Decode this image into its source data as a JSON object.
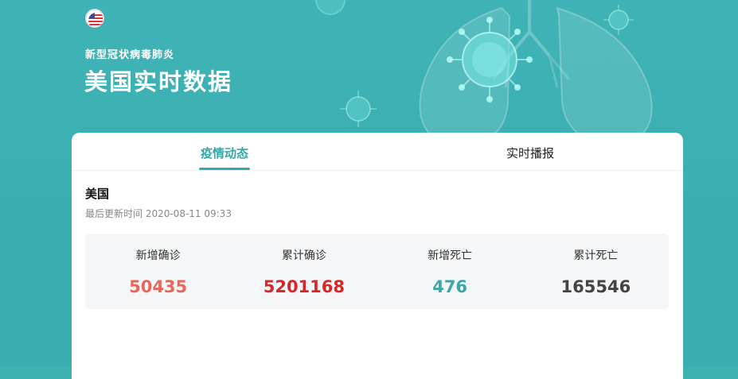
{
  "header": {
    "subtitle": "新型冠状病毒肺炎",
    "title": "美国实时数据"
  },
  "tabs": [
    {
      "label": "疫情动态",
      "active": true
    },
    {
      "label": "实时播报",
      "active": false
    }
  ],
  "region": {
    "name": "美国",
    "updated": "最后更新时间 2020-08-11 09:33"
  },
  "stats": [
    {
      "label": "新增确诊",
      "value": "50435",
      "color": "#e8675a"
    },
    {
      "label": "累计确诊",
      "value": "5201168",
      "color": "#d4282b"
    },
    {
      "label": "新增死亡",
      "value": "476",
      "color": "#3aa7a8"
    },
    {
      "label": "累计死亡",
      "value": "165546",
      "color": "#444444"
    }
  ],
  "colors": {
    "accent": "#35a8ab",
    "hero_bg": "#3fb1b3"
  },
  "icons": {
    "flag": "us-flag-icon",
    "virus": "virus-icon",
    "lungs": "lungs-illustration"
  }
}
